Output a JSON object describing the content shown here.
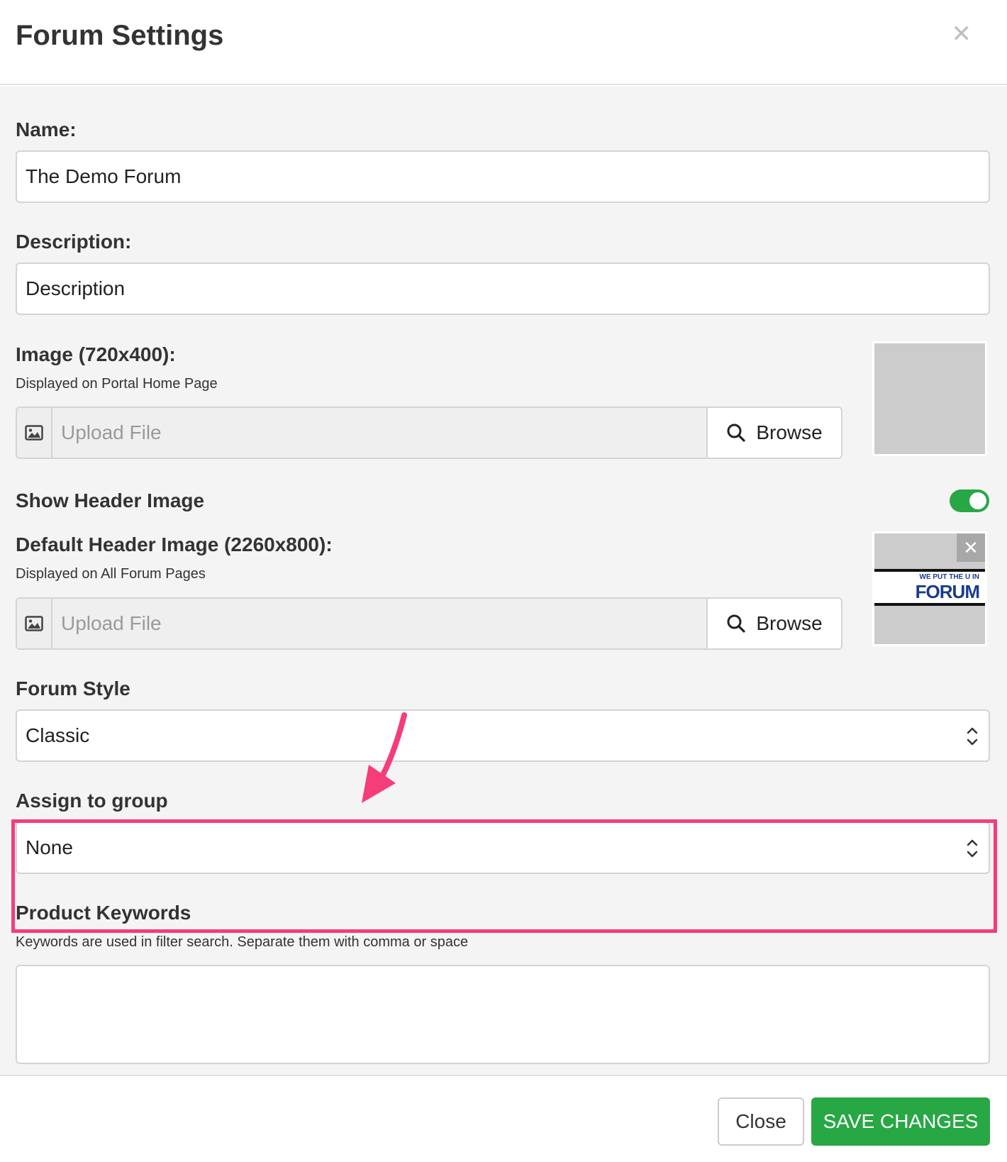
{
  "modal": {
    "title": "Forum Settings",
    "close_icon": "close-icon"
  },
  "fields": {
    "name": {
      "label": "Name:",
      "value": "The Demo Forum"
    },
    "description": {
      "label": "Description:",
      "value": "Description"
    },
    "image": {
      "label": "Image (720x400):",
      "hint": "Displayed on Portal Home Page",
      "placeholder": "Upload File",
      "browse_label": "Browse"
    },
    "show_header_image": {
      "label": "Show Header Image",
      "enabled": true
    },
    "default_header_image": {
      "label": "Default Header Image (2260x800):",
      "hint": "Displayed on All Forum Pages",
      "placeholder": "Upload File",
      "browse_label": "Browse",
      "thumbnail_text_small": "WE PUT THE U IN",
      "thumbnail_text_big": "FORUM"
    },
    "forum_style": {
      "label": "Forum Style",
      "selected": "Classic"
    },
    "assign_to_group": {
      "label": "Assign to group",
      "selected": "None"
    },
    "product_keywords": {
      "label": "Product Keywords",
      "hint": "Keywords are used in filter search. Separate them with comma or space",
      "value": ""
    }
  },
  "footer": {
    "close_label": "Close",
    "save_label": "SAVE CHANGES"
  },
  "colors": {
    "accent_green": "#28a745",
    "highlight_pink": "#f53d7a"
  }
}
